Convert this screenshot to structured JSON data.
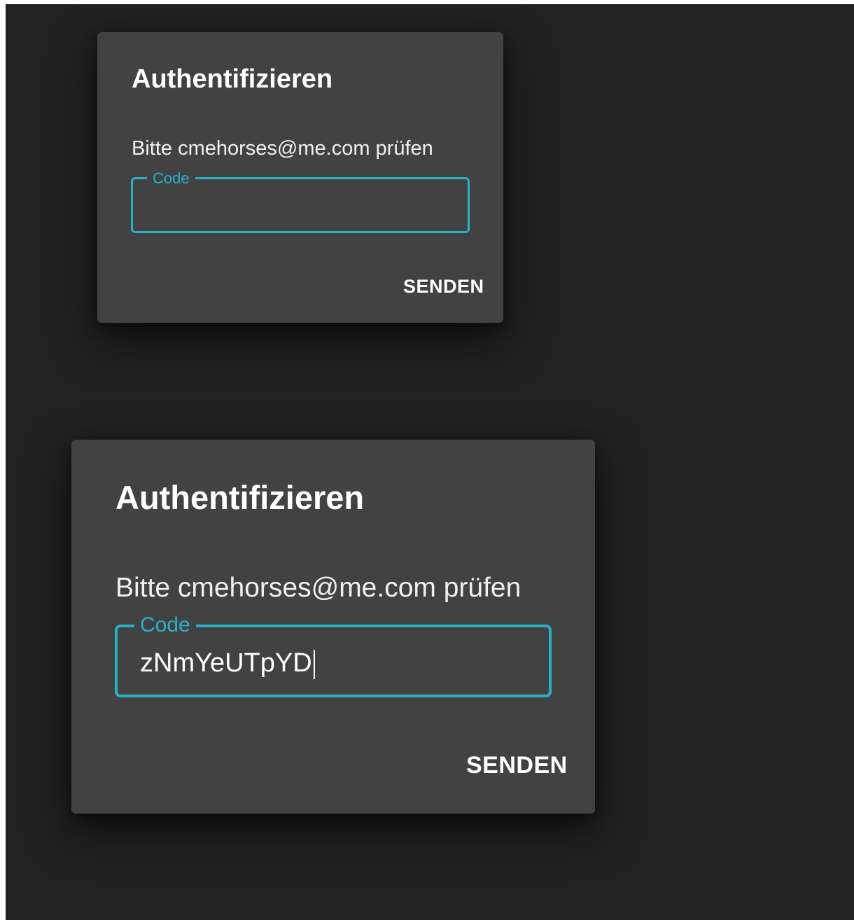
{
  "dialogs": [
    {
      "title": "Authentifizieren",
      "message": "Bitte cmehorses@me.com prüfen",
      "code_label": "Code",
      "code_value": "",
      "submit_label": "SENDEN"
    },
    {
      "title": "Authentifizieren",
      "message": "Bitte cmehorses@me.com prüfen",
      "code_label": "Code",
      "code_value": "zNmYeUTpYD",
      "submit_label": "SENDEN"
    }
  ],
  "colors": {
    "background": "#212121",
    "dialog": "#424242",
    "accent": "#26b3c9",
    "text": "#ffffff"
  }
}
